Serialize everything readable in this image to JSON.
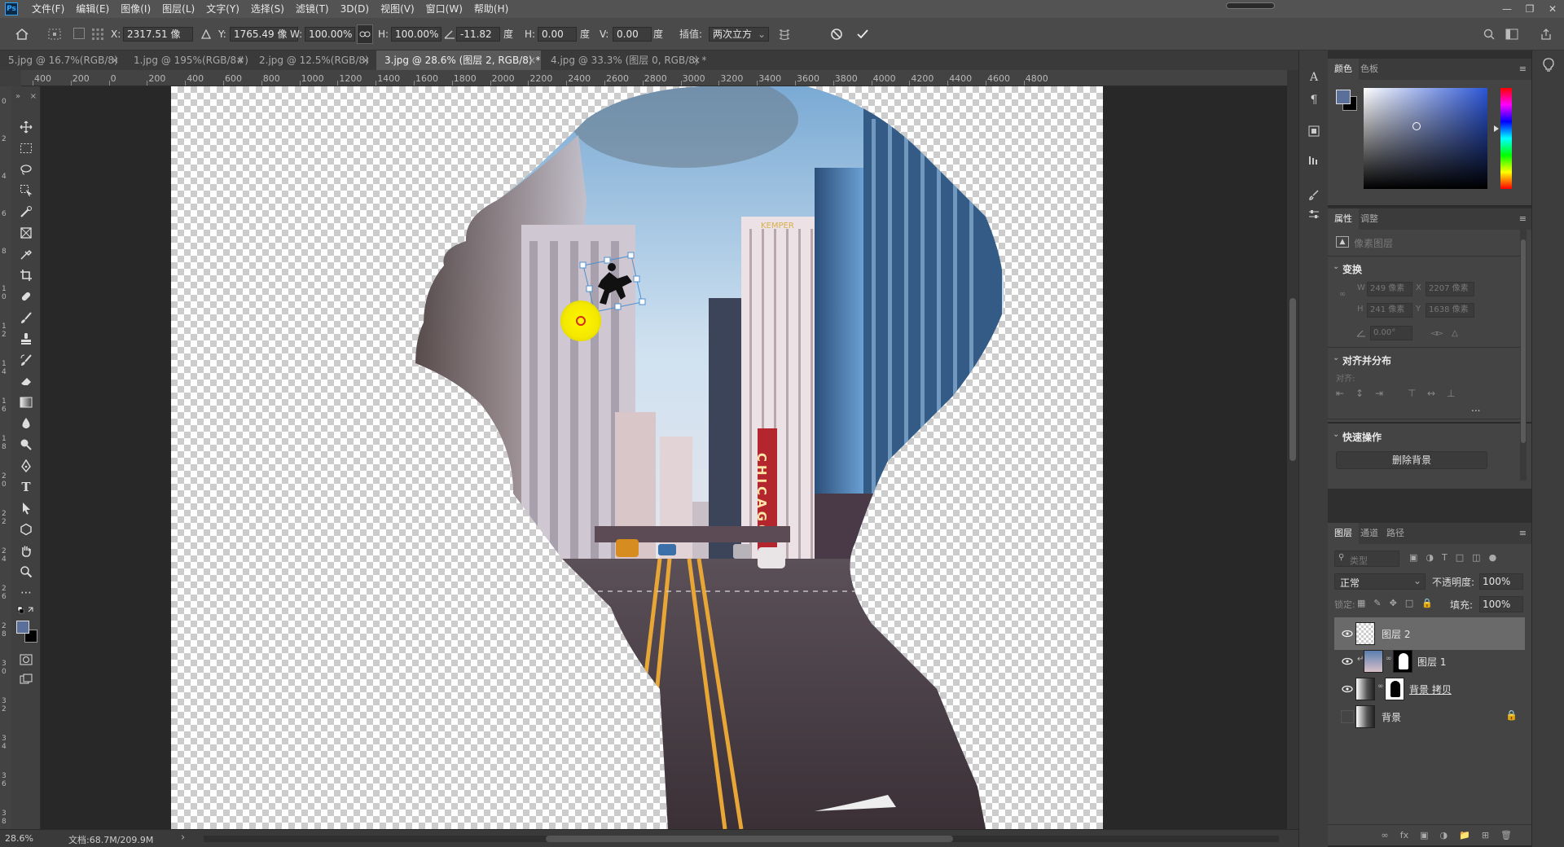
{
  "menubar": {
    "logo": "Ps",
    "items": [
      "文件(F)",
      "编辑(E)",
      "图像(I)",
      "图层(L)",
      "文字(Y)",
      "选择(S)",
      "滤镜(T)",
      "3D(D)",
      "视图(V)",
      "窗口(W)",
      "帮助(H)"
    ]
  },
  "options": {
    "x_label": "X:",
    "x_value": "2317.51 像",
    "y_label": "Y:",
    "y_value": "1765.49 像",
    "w_label": "W:",
    "w_value": "100.00%",
    "h_label": "H:",
    "h_value": "100.00%",
    "angle_value": "-11.82",
    "angle_unit": "度",
    "hskew_label": "H:",
    "hskew_value": "0.00",
    "hskew_unit": "度",
    "vskew_label": "V:",
    "vskew_value": "0.00",
    "vskew_unit": "度",
    "interp_label": "插值:",
    "interp_value": "两次立方"
  },
  "tabs": [
    {
      "label": "5.jpg @ 16.7%(RGB/8)",
      "active": false
    },
    {
      "label": "1.jpg @ 195%(RGB/8#)",
      "active": false
    },
    {
      "label": "2.jpg @ 12.5%(RGB/8)",
      "active": false
    },
    {
      "label": "3.jpg @ 28.6% (图层 2, RGB/8) *",
      "active": true
    },
    {
      "label": "4.jpg @ 33.3% (图层 0, RGB/8) *",
      "active": false
    }
  ],
  "ruler_h": [
    "400",
    "200",
    "0",
    "200",
    "400",
    "600",
    "800",
    "1000",
    "1200",
    "1400",
    "1600",
    "1800",
    "2000",
    "2200",
    "2400",
    "2600",
    "2800",
    "3000",
    "3200",
    "3400",
    "3600",
    "3800",
    "4000",
    "4200",
    "4400",
    "4600",
    "4800"
  ],
  "ruler_v": [
    "0",
    "2",
    "4",
    "6",
    "8",
    "1 0",
    "1 2",
    "1 4",
    "1 6",
    "1 8",
    "2 0",
    "2 2",
    "2 4",
    "2 6",
    "2 8",
    "3 0",
    "3 2",
    "3 4",
    "3 6",
    "3 8"
  ],
  "canvas": {
    "sign_text": "CHICAGO",
    "hotel_text": "KEMPER"
  },
  "status": {
    "zoom": "28.6%",
    "doc": "文档:68.7M/209.9M",
    "arrow": "›"
  },
  "color_panel": {
    "tabs": [
      "颜色",
      "色板"
    ],
    "fg_color": "#5a6f9a",
    "bg_color": "#000000"
  },
  "properties": {
    "tabs": [
      "属性",
      "调整"
    ],
    "layer_kind": "像素图层",
    "transform_title": "变换",
    "w_label": "W",
    "w_value": "249 像素",
    "x_label": "X",
    "x_value": "2207 像素",
    "h_label": "H",
    "h_value": "241 像素",
    "y_label": "Y",
    "y_value": "1638 像素",
    "angle_value": "0.00°",
    "align_title": "对齐并分布",
    "align_label": "对齐:",
    "quick_title": "快速操作",
    "remove_bg": "删除背景",
    "more": "..."
  },
  "layers_panel": {
    "tabs": [
      "图层",
      "通道",
      "路径"
    ],
    "filter_placeholder": "类型",
    "blend_mode": "正常",
    "opacity_label": "不透明度:",
    "opacity_value": "100%",
    "lock_label": "锁定:",
    "fill_label": "填充:",
    "fill_value": "100%",
    "layers": [
      {
        "name": "图层 2",
        "selected": true,
        "visible": true
      },
      {
        "name": "图层 1",
        "selected": false,
        "visible": true
      },
      {
        "name": "背景 拷贝",
        "selected": false,
        "visible": true
      },
      {
        "name": "背景",
        "selected": false,
        "visible": false
      }
    ]
  }
}
